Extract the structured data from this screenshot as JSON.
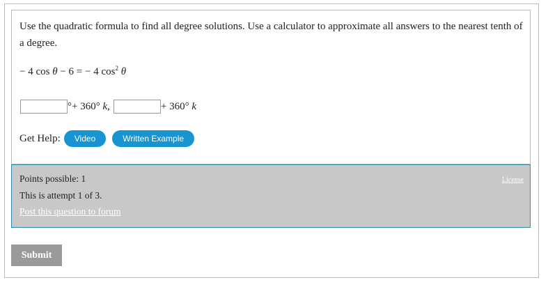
{
  "question": {
    "prompt": "Use the quadratic formula to find all degree solutions. Use a calculator to approximate all answers to the nearest tenth of a degree.",
    "equation": {
      "lhs_a": "− 4 cos ",
      "theta": "θ",
      "lhs_b": " − 6 = − 4 cos",
      "exponent": "2"
    },
    "answer_1": {
      "value": "",
      "suffix": "°+ 360° ",
      "k": "k",
      "comma": ","
    },
    "answer_2": {
      "value": "",
      "suffix": "+ 360° ",
      "k": "k"
    }
  },
  "help": {
    "label": "Get Help:",
    "video_label": "Video",
    "example_label": "Written Example"
  },
  "info": {
    "points": "Points possible: 1",
    "attempt": "This is attempt 1 of 3.",
    "forum_link": "Post this question to forum",
    "license": "License"
  },
  "submit_label": "Submit",
  "colors": {
    "pill": "#1794d1",
    "info_bg": "#c8c8c8",
    "info_border": "#2f8ca9",
    "submit_bg": "#9a9a9a"
  }
}
